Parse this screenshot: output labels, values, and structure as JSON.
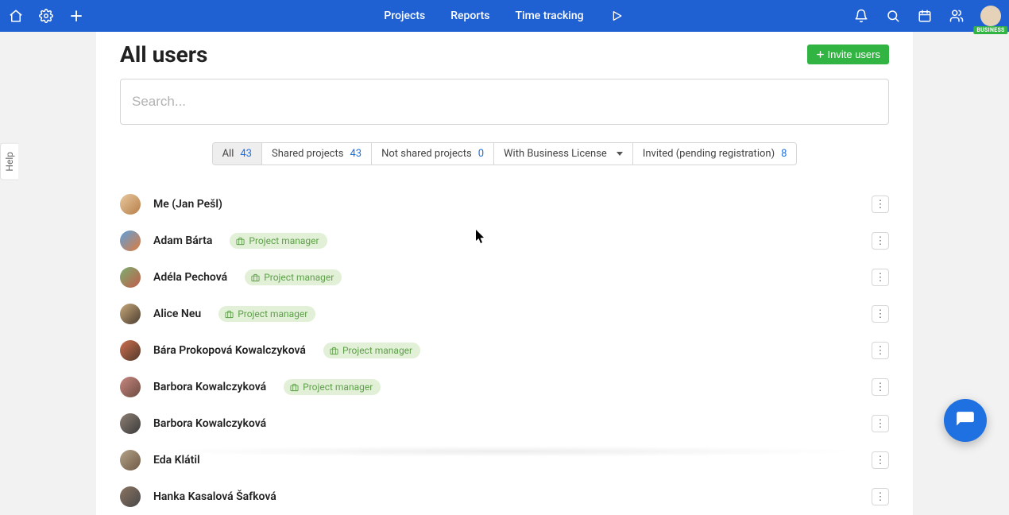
{
  "nav": {
    "projects": "Projects",
    "reports": "Reports",
    "time_tracking": "Time tracking",
    "business_badge": "BUSINESS"
  },
  "help_tab": "Help",
  "header": {
    "title": "All users",
    "invite_label": "Invite users"
  },
  "search": {
    "placeholder": "Search...",
    "value": ""
  },
  "filters": {
    "all": {
      "label": "All",
      "count": "43"
    },
    "shared": {
      "label": "Shared projects",
      "count": "43"
    },
    "not_shared": {
      "label": "Not shared projects",
      "count": "0"
    },
    "business": {
      "label": "With Business License"
    },
    "invited": {
      "label": "Invited (pending registration)",
      "count": "8"
    }
  },
  "role_label": "Project manager",
  "users": [
    {
      "name": "Me (Jan Pešl)",
      "role": null,
      "avatar": "av1"
    },
    {
      "name": "Adam Bárta",
      "role": "Project manager",
      "avatar": "av2"
    },
    {
      "name": "Adéla Pechová",
      "role": "Project manager",
      "avatar": "av3"
    },
    {
      "name": "Alice Neu",
      "role": "Project manager",
      "avatar": "av4"
    },
    {
      "name": "Bára Prokopová Kowalczyková",
      "role": "Project manager",
      "avatar": "av5"
    },
    {
      "name": "Barbora Kowalczyková",
      "role": "Project manager",
      "avatar": "av6"
    },
    {
      "name": "Barbora Kowalczyková",
      "role": null,
      "avatar": "av7"
    },
    {
      "name": "Eda Klátil",
      "role": null,
      "avatar": "av8"
    },
    {
      "name": "Hanka Kasalová Šafková",
      "role": null,
      "avatar": "av9"
    }
  ]
}
